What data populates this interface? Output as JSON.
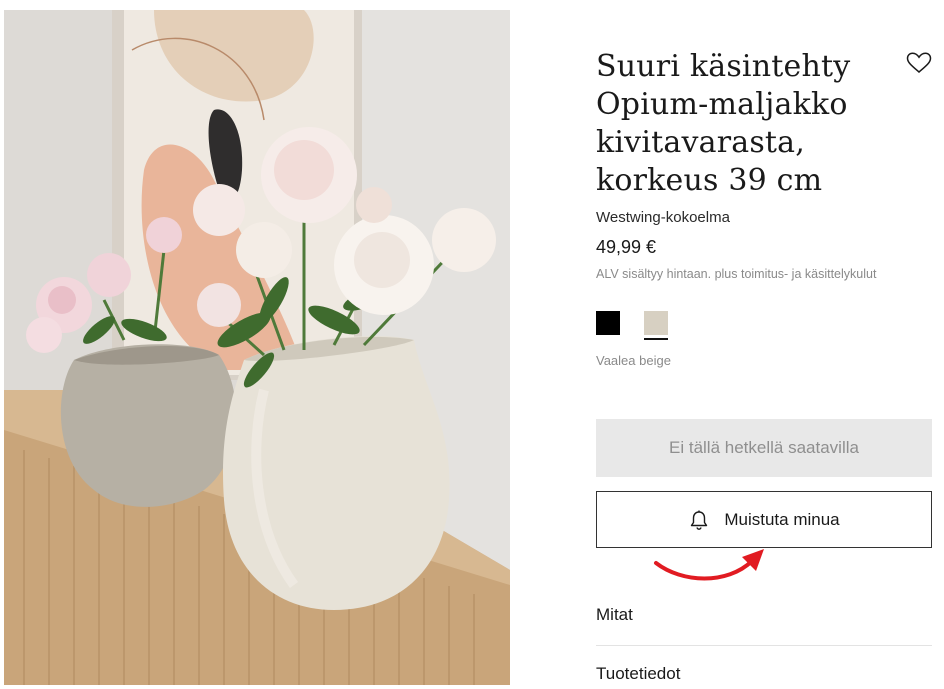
{
  "product": {
    "title_lines": [
      "Suuri käsintehty",
      "Opium-maljakko",
      "kivitavarasta,",
      "korkeus 39 cm"
    ],
    "collection": "Westwing-kokoelma",
    "price": "49,99 €",
    "vat_note": "ALV sisältyy hintaan. plus toimitus- ja käsittelykulut",
    "colors": [
      {
        "name": "black",
        "hex": "#000000"
      },
      {
        "name": "Vaalea beige",
        "hex": "#d7d0c2"
      }
    ],
    "selected_color_label": "Vaalea beige"
  },
  "buttons": {
    "unavailable_label": "Ei tällä hetkellä saatavilla",
    "remind_label": "Muistuta minua"
  },
  "accordion": {
    "items": [
      "Mitat",
      "Tuotetiedot"
    ]
  },
  "icons": {
    "wishlist": "heart-icon",
    "remind": "bell-icon"
  },
  "theme": {
    "annotation_arrow": "#e11b22",
    "unavailable_bg": "#e8e8e8"
  }
}
